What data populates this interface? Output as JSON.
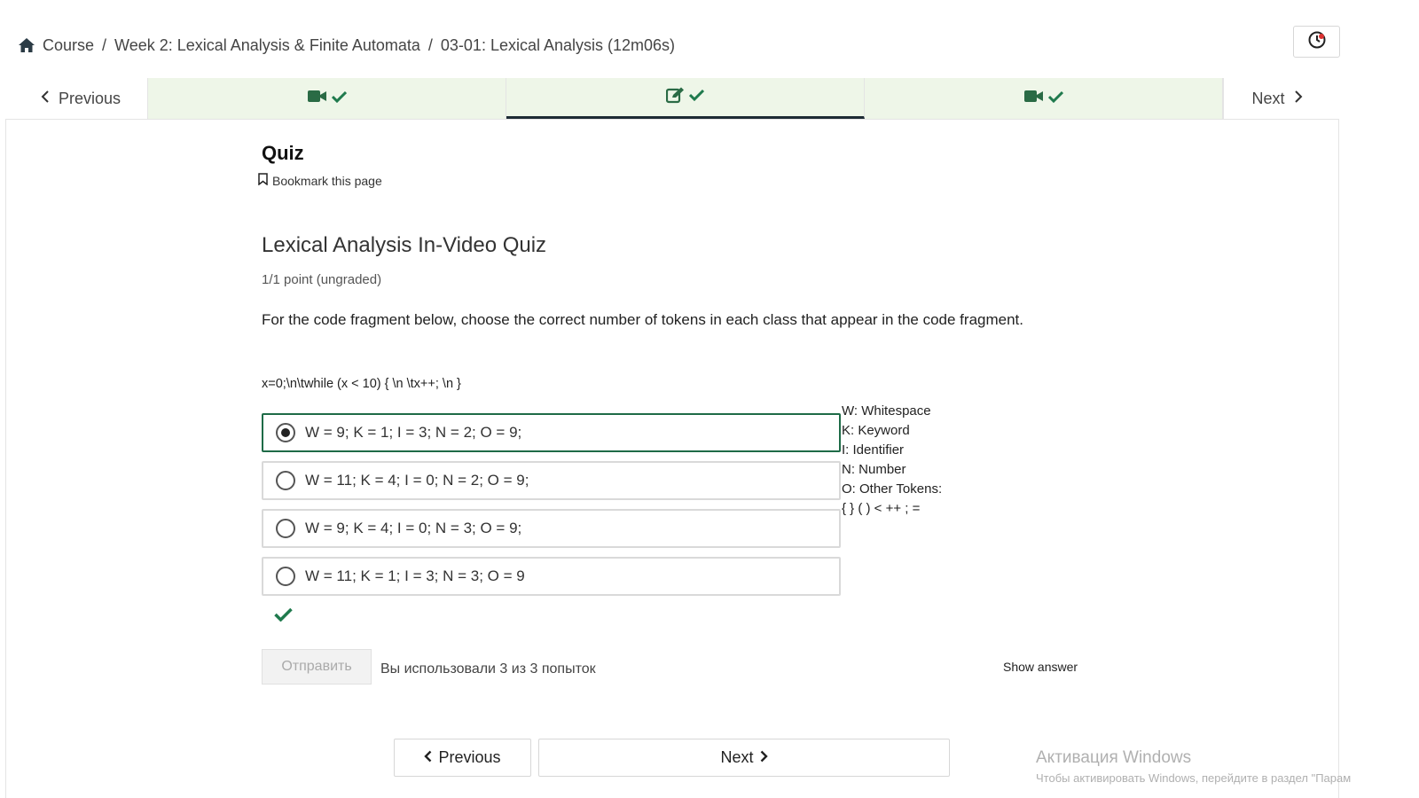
{
  "breadcrumb": {
    "course": "Course",
    "week": "Week 2: Lexical Analysis & Finite Automata",
    "lecture": "03-01: Lexical Analysis (12m06s)",
    "separator": "/"
  },
  "sequence_nav": {
    "previous_label": "Previous",
    "next_label": "Next",
    "units": [
      {
        "icon": "video-icon",
        "completed": true
      },
      {
        "icon": "edit-icon",
        "completed": true,
        "active": true
      },
      {
        "icon": "video-icon",
        "completed": true
      }
    ]
  },
  "unit": {
    "title": "Quiz",
    "bookmark_label": "Bookmark this page"
  },
  "problem": {
    "title": "Lexical Analysis In-Video Quiz",
    "points": "1/1 point (ungraded)",
    "question": "For the code fragment below, choose the correct number of tokens in each class that appear in the code fragment.",
    "code": "x=0;\\n\\twhile (x < 10) { \\n \\tx++; \\n }",
    "choices": [
      {
        "label": "W = 9; K = 1; I = 3; N = 2; O = 9;",
        "selected": true
      },
      {
        "label": "W = 11; K = 4; I = 0; N = 2; O = 9;",
        "selected": false
      },
      {
        "label": "W = 9; K = 4; I = 0; N = 3; O = 9;",
        "selected": false
      },
      {
        "label": "W = 11; K = 1; I = 3; N = 3; O = 9",
        "selected": false
      }
    ],
    "legend": [
      "W: Whitespace",
      "K: Keyword",
      "I: Identifier",
      "N: Number",
      "O: Other Tokens:",
      "{ } ( ) < ++ ; ="
    ],
    "status": "correct",
    "submit_label": "Отправить",
    "attempts": "Вы использовали 3 из 3 попыток",
    "show_answer_label": "Show answer"
  },
  "bottom_nav": {
    "previous_label": "Previous",
    "next_label": "Next"
  },
  "watermark": {
    "title": "Активация Windows",
    "subtitle": "Чтобы активировать Windows, перейдите в раздел \"Парам"
  },
  "colors": {
    "accent_green": "#1e6b47",
    "unit_bg": "#eef6e8",
    "check_green": "#1f7a4d"
  }
}
